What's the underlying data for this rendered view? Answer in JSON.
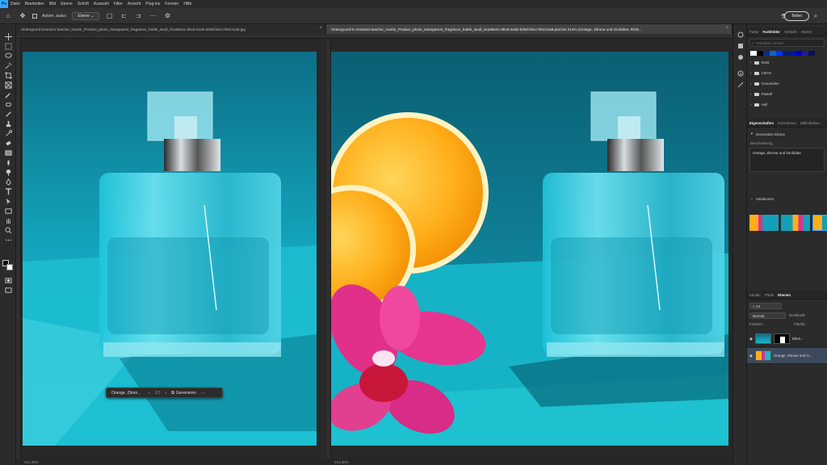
{
  "menu": {
    "app_badge": "Ps",
    "items": [
      "Datei",
      "Bearbeiten",
      "Bild",
      "Ebene",
      "Schrift",
      "Auswahl",
      "Filter",
      "Ansicht",
      "Plug-ins",
      "Fenster",
      "Hilfe"
    ]
  },
  "options_bar": {
    "auto_select_label": "Autom. ausw.:",
    "target_select": "Ebene",
    "share_button": "Teilen"
  },
  "documents": [
    {
      "tab_title": "Hintergrund-ersetzen-teacher_martin_Product_photo_transparent_fragrance_bottle_studi_0ca36e4c-0bc9-4ede-b00d-b6cc7b0c21a9.jpg",
      "status": "214,36%"
    },
    {
      "tab_title": "Hintergrund-G ersetzen-teacher_martin_Product_photo_transparent_fragrance_bottle_studi_0ca36e4c-0bc9-4ede-b00d-b6cc7b0c21a9.psd bei 214% (Orange, Zitrone und Orchidee, RGB...",
      "status": "214,36%"
    }
  ],
  "context_bar": {
    "prompt": "Orange, Zitron...",
    "counter": "3/3",
    "generate_label": "Generieren"
  },
  "color_panel": {
    "tabs": [
      "Farbe",
      "Farbfelder",
      "Verläufe",
      "Muster"
    ],
    "active_tab": "Farbfelder",
    "search_placeholder": "Farbfelder suchen",
    "folders": [
      "RGB",
      "CMYK",
      "Graustufen",
      "Pastell",
      "Hell"
    ],
    "swatch_colors": [
      "#ffffff",
      "#000000",
      "#0b2a8a",
      "#1565c0",
      "#0033ff",
      "#002266",
      "#001a99",
      "#0000cc",
      "#1e1e8a",
      "#0d0d5c"
    ]
  },
  "properties_panel": {
    "tabs": [
      "Eigenschaften",
      "Korrekturen",
      "Bibliotheken"
    ],
    "active_tab": "Eigenschaften",
    "layer_type": "Generative Ebene",
    "description_label": "Beschreibung",
    "description": "Orange, Zitrone und Orchidee",
    "variations_label": "Variationen"
  },
  "layers_panel": {
    "tabs": [
      "Kanäle",
      "Pfade",
      "Ebenen"
    ],
    "active_tab": "Ebenen",
    "filter_select": "Art",
    "blend_mode": "Normal",
    "opacity_label": "Deckkraft:",
    "fill_label": "Fläche:",
    "lock_label": "Fixieren:",
    "layers": [
      {
        "name": "Eben..."
      },
      {
        "name": "Orange, Zitrone und O..."
      }
    ]
  }
}
